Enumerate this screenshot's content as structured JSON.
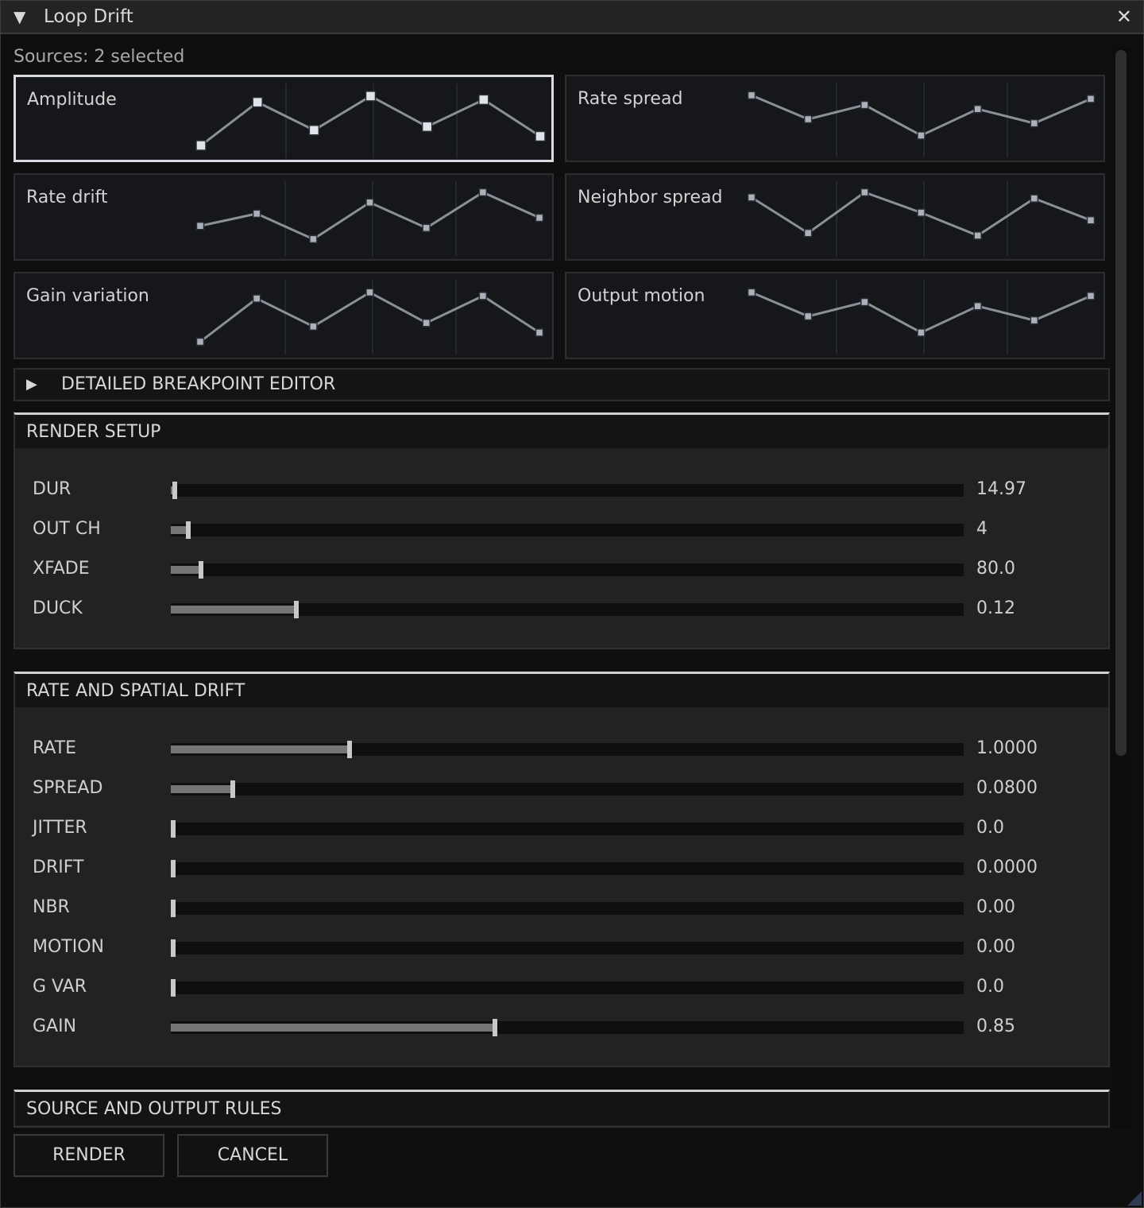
{
  "window": {
    "title": "Loop Drift",
    "collapse_icon": "▼",
    "close_icon": "✕"
  },
  "sources_label": "Sources: 2 selected",
  "curves": [
    {
      "label": "Amplitude",
      "selected": true,
      "points": [
        0.0,
        0.85,
        0.3,
        0.97,
        0.37,
        0.9,
        0.18
      ]
    },
    {
      "label": "Rate spread",
      "selected": false,
      "points": [
        0.97,
        0.5,
        0.78,
        0.18,
        0.7,
        0.42,
        0.9
      ]
    },
    {
      "label": "Rate drift",
      "selected": false,
      "points": [
        0.34,
        0.58,
        0.08,
        0.8,
        0.3,
        1.0,
        0.5
      ]
    },
    {
      "label": "Neighbor spread",
      "selected": false,
      "points": [
        0.9,
        0.2,
        1.0,
        0.6,
        0.15,
        0.88,
        0.45
      ]
    },
    {
      "label": "Gain variation",
      "selected": false,
      "points": [
        0.0,
        0.85,
        0.3,
        0.97,
        0.37,
        0.9,
        0.18
      ]
    },
    {
      "label": "Output motion",
      "selected": false,
      "points": [
        0.97,
        0.5,
        0.78,
        0.18,
        0.7,
        0.42,
        0.9
      ]
    }
  ],
  "breakpoint_editor": {
    "label": "DETAILED BREAKPOINT EDITOR",
    "icon": "▶"
  },
  "render_setup": {
    "title": "RENDER SETUP",
    "sliders": [
      {
        "label": "DUR",
        "value": "14.97",
        "fraction": 0.005
      },
      {
        "label": "OUT CH",
        "value": "4",
        "fraction": 0.022
      },
      {
        "label": "XFADE",
        "value": "80.0",
        "fraction": 0.038
      },
      {
        "label": "DUCK",
        "value": "0.12",
        "fraction": 0.158
      }
    ]
  },
  "rate_spatial": {
    "title": "RATE AND SPATIAL DRIFT",
    "sliders": [
      {
        "label": "RATE",
        "value": "1.0000",
        "fraction": 0.225
      },
      {
        "label": "SPREAD",
        "value": "0.0800",
        "fraction": 0.078
      },
      {
        "label": "JITTER",
        "value": "0.0",
        "fraction": 0.003
      },
      {
        "label": "DRIFT",
        "value": "0.0000",
        "fraction": 0.003
      },
      {
        "label": "NBR",
        "value": "0.00",
        "fraction": 0.003
      },
      {
        "label": "MOTION",
        "value": "0.00",
        "fraction": 0.003
      },
      {
        "label": "G VAR",
        "value": "0.0",
        "fraction": 0.003
      },
      {
        "label": "GAIN",
        "value": "0.85",
        "fraction": 0.409
      }
    ]
  },
  "source_output": {
    "title": "SOURCE AND OUTPUT RULES"
  },
  "buttons": {
    "render": "RENDER",
    "cancel": "CANCEL"
  }
}
